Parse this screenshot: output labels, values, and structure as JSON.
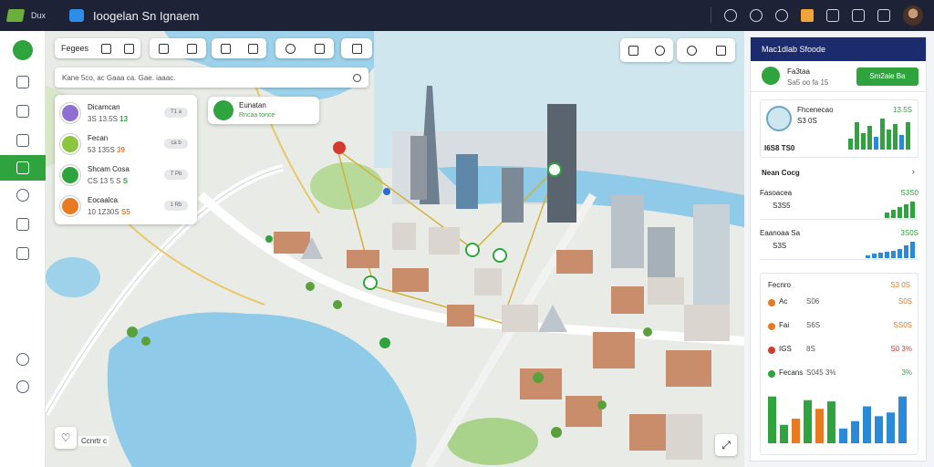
{
  "app": {
    "brand": "Dux",
    "title": "Ioogelan Sn Ignaem"
  },
  "map": {
    "toolbar_label": "Fegees",
    "search_placeholder": "Kane 5co, ac Gaaa ca. Gae. iaaac.",
    "popup": {
      "title": "Eunatan",
      "subtitle": "Rncaa tonce"
    },
    "bottom_label": "Ccnrtr c",
    "list": [
      {
        "name": "Dicamcan",
        "meta_a": "3S 13.5S",
        "meta_b": "13",
        "pill": "T1 a",
        "color": "#8f6fd2"
      },
      {
        "name": "Fecan",
        "meta_a": "53 135S",
        "meta_b": "39",
        "pill": "ca b",
        "color": "#8cc63f"
      },
      {
        "name": "Shcam Cosa",
        "meta_a": "CS 13 5 S",
        "meta_b": "S",
        "pill": "T Pb",
        "color": "#2fa33e"
      },
      {
        "name": "Eocaalca",
        "meta_a": "10 1Z30S",
        "meta_b": "S5",
        "pill": "1 Rb",
        "color": "#e87a22"
      }
    ]
  },
  "panel": {
    "header": "Mac1dlab Sfoode",
    "top_card": {
      "name": "Fa3taa",
      "sub": "Sa5 oo fa 15",
      "button": "Sm2aie Ba"
    },
    "profile_card": {
      "title": "Fhcenecao",
      "sub": "S3 0S",
      "value": "13.5S",
      "footer": "I6S8 TS0"
    },
    "section_title": "Nean Cocg",
    "metrics": [
      {
        "name": "Fasoacea",
        "value": "S3S0",
        "sub": "S3S5",
        "bars": [
          6,
          9,
          12,
          15,
          18
        ]
      },
      {
        "name": "Eaanoaa Sa",
        "value": "3S0S",
        "sub": "S3S",
        "bars": [
          3,
          4,
          5,
          6,
          7,
          9,
          12,
          16
        ]
      }
    ],
    "stats_header": {
      "title": "Fecnro",
      "value": "S3 0S"
    },
    "stats": [
      {
        "name": "Ac",
        "label": "S06",
        "value": "S0S",
        "accent": "#e87a22"
      },
      {
        "name": "Fai",
        "label": "S6S",
        "value": "SS0S",
        "accent": "#e87a22"
      },
      {
        "name": "IGS",
        "label": "8S",
        "value": "S0 3%",
        "accent": "#d43b2e"
      },
      {
        "name": "Fecans",
        "label": "S045 3%",
        "value": "3%",
        "accent": "#2fa33e"
      }
    ],
    "chart_data": {
      "type": "bar",
      "series": [
        {
          "values": [
            38,
            15,
            20,
            35,
            28,
            34,
            12,
            18,
            30,
            22,
            25,
            38
          ]
        }
      ]
    }
  },
  "colors": {
    "accent": "#2fa33e",
    "header": "#1c2b6e",
    "topbar": "#1e2236",
    "water": "#8fcbe8"
  }
}
